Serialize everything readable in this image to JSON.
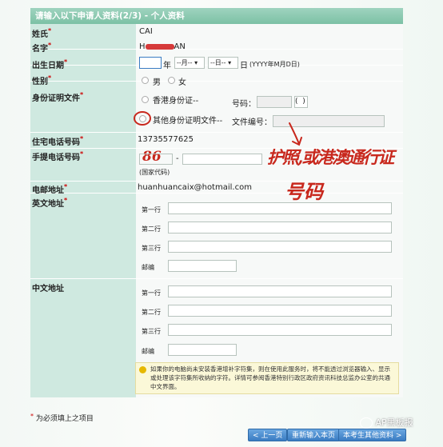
{
  "form": {
    "title": "请输入以下申请人资料(2/3) - 个人资料",
    "required_mark": "*",
    "surname_label": "姓氏",
    "surname_value": "CAI",
    "given_name_label": "名字",
    "given_name_value": "H",
    "given_name_tail": "AN",
    "dob_label": "出生日期",
    "year_unit": "年",
    "month_placeholder": "--月--",
    "day_placeholder": "--日--",
    "day_unit": "日",
    "dob_format_hint": "(YYYY年M月D日)",
    "gender_label": "性别",
    "gender_male": "男",
    "gender_female": "女",
    "id_doc_label": "身份证明文件",
    "id_hk_option": "香港身份证--",
    "id_number_label": "号码：",
    "id_check_open": "(",
    "id_check_close": ")",
    "id_other_option": "其他身份证明文件--",
    "doc_number_label": "文件编号：",
    "home_phone_label": "住宅电话号码",
    "home_phone_value": "13735577625",
    "mobile_label": "手提电话号码",
    "country_code_handwritten": "86",
    "phone_dash": "-",
    "country_code_caption": "(国家代码)",
    "email_label": "电邮地址",
    "email_value": "huanhuancaix@hotmail.com",
    "english_address_label": "英文地址",
    "chinese_address_label": "中文地址",
    "line1": "第一行",
    "line2": "第二行",
    "line3": "第三行",
    "postcode": "邮编",
    "notice": "如果你的电脑尚未安装香港增补字符集，则在使用此服务时，将不能透过浏览器输入、显示或处理该字符集所收纳的字符。详情可参阅香港特别行政区政府资讯科技总监办公室的共通中文界面。"
  },
  "annotation": {
    "line1": "护照,或港澳通行证",
    "line2": "号码"
  },
  "footer": {
    "required_note_mark": "*",
    "required_note": "为必须填上之项目",
    "prev_button": "< 上一页",
    "reset_button": "重新输入本页",
    "next_button": "本考生其他资料 >",
    "watermark": "AP黑板报"
  },
  "colors": {
    "header": "#7cc1a5",
    "label_column": "#cfe9e0",
    "required": "#cc0000",
    "handwriting": "#c8281d",
    "button": "#3a7cc3"
  }
}
